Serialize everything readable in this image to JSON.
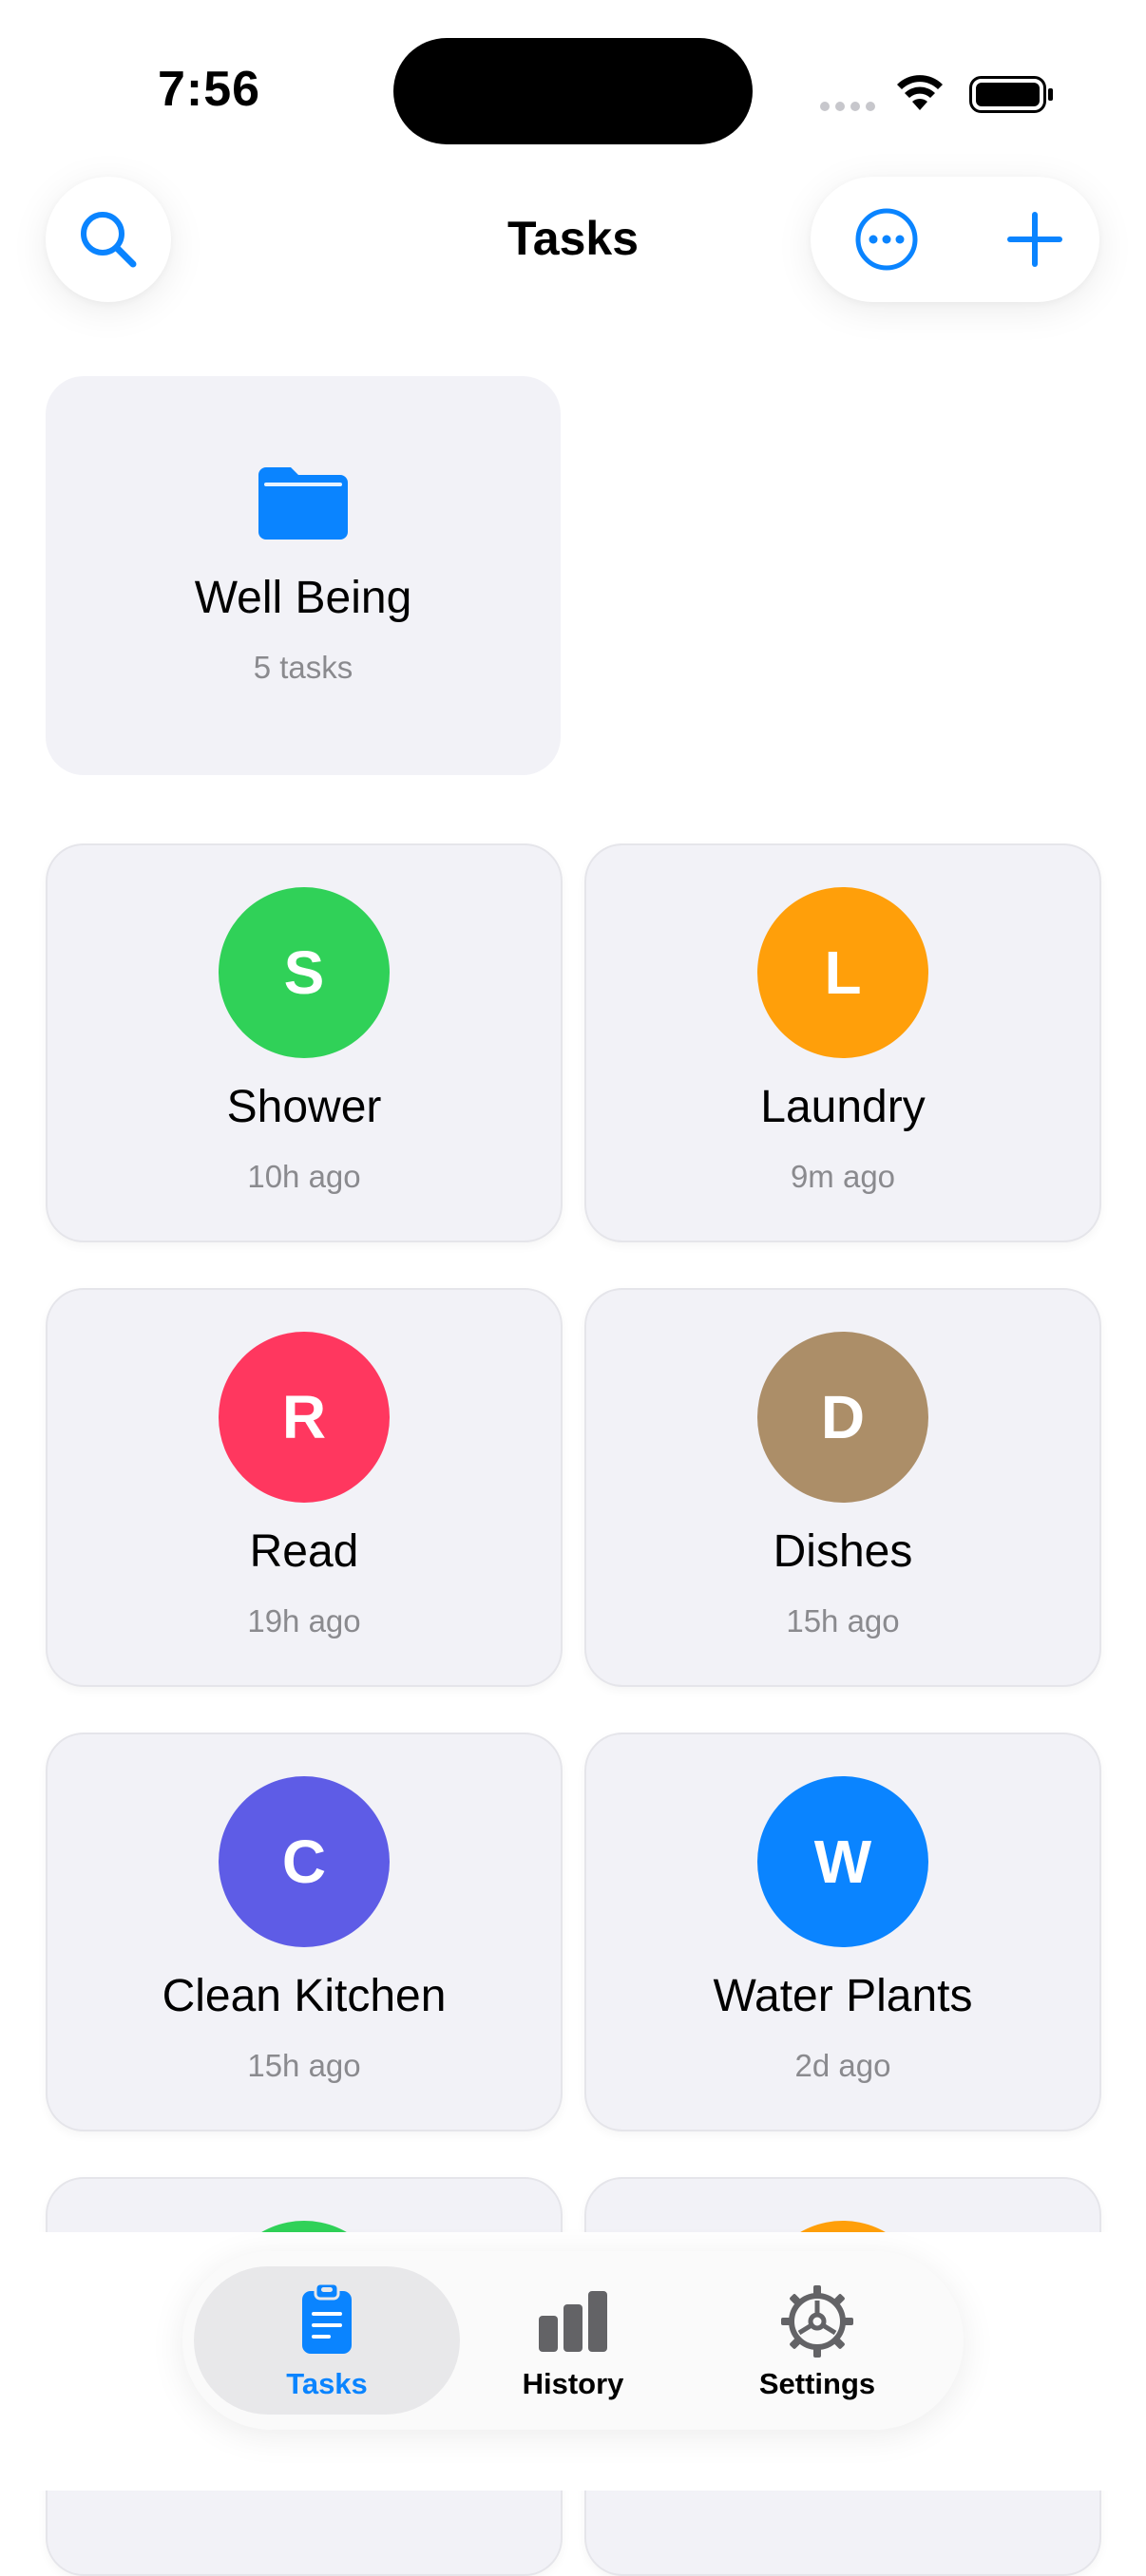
{
  "status_bar": {
    "time": "7:56",
    "icons": [
      "signal-icon",
      "wifi-icon",
      "battery-icon"
    ]
  },
  "header": {
    "title": "Tasks",
    "search_icon": "search-icon",
    "more_icon": "ellipsis-circle-icon",
    "add_icon": "plus-icon"
  },
  "folder": {
    "name": "Well Being",
    "count": "5 tasks",
    "icon": "folder-icon"
  },
  "tasks": [
    {
      "initial": "S",
      "name": "Shower",
      "time": "10h ago",
      "color": "#30d158"
    },
    {
      "initial": "L",
      "name": "Laundry",
      "time": "9m ago",
      "color": "#ff9f0a"
    },
    {
      "initial": "R",
      "name": "Read",
      "time": "19h ago",
      "color": "#ff375f"
    },
    {
      "initial": "D",
      "name": "Dishes",
      "time": "15h ago",
      "color": "#ac8e68"
    },
    {
      "initial": "C",
      "name": "Clean Kitchen",
      "time": "15h ago",
      "color": "#5e5ce6"
    },
    {
      "initial": "W",
      "name": "Water Plants",
      "time": "2d ago",
      "color": "#0a84ff"
    },
    {
      "initial": "",
      "name": "",
      "time": "",
      "color": "#30d158"
    },
    {
      "initial": "",
      "name": "",
      "time": "",
      "color": "#ff9f0a"
    }
  ],
  "tab_bar": {
    "tabs": [
      {
        "label": "Tasks",
        "icon": "clipboard-icon",
        "active": true
      },
      {
        "label": "History",
        "icon": "bar-chart-icon",
        "active": false
      },
      {
        "label": "Settings",
        "icon": "gear-icon",
        "active": false
      }
    ]
  },
  "colors": {
    "accent": "#0a84ff",
    "card_bg": "#f2f2f7",
    "secondary_text": "#8a8a8e",
    "inactive_icon": "#636366"
  }
}
